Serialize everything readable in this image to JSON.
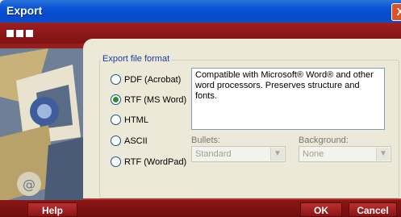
{
  "window": {
    "title": "Export",
    "close_glyph": "X"
  },
  "export_format": {
    "legend": "Export file format",
    "options": [
      {
        "label": "PDF (Acrobat)",
        "checked": false
      },
      {
        "label": "RTF (MS Word)",
        "checked": true
      },
      {
        "label": "HTML",
        "checked": false
      },
      {
        "label": "ASCII",
        "checked": false
      },
      {
        "label": "RTF (WordPad)",
        "checked": false
      }
    ],
    "description": "Compatible with Microsoft® Word® and other word processors. Preserves structure and fonts."
  },
  "bullets": {
    "label": "Bullets:",
    "value": "Standard"
  },
  "background": {
    "label": "Background:",
    "value": "None"
  },
  "buttons": {
    "help": "Help",
    "ok": "OK",
    "cancel": "Cancel"
  },
  "colors": {
    "title_bar": "#0a54d6",
    "frame_red": "#9e1f1f",
    "dialog_bg": "#ece9d8"
  }
}
